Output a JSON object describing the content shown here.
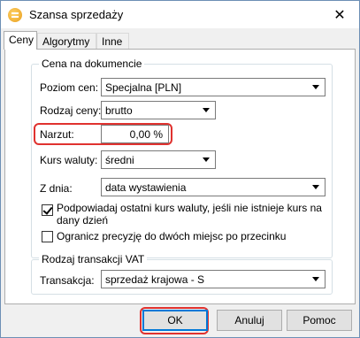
{
  "window": {
    "title": "Szansa sprzedaży",
    "close_glyph": "✕"
  },
  "tabs": [
    {
      "label": "Ceny",
      "active": true
    },
    {
      "label": "Algorytmy",
      "active": false
    },
    {
      "label": "Inne",
      "active": false
    }
  ],
  "price_group": {
    "legend": "Cena na dokumencie",
    "price_level": {
      "label": "Poziom cen:",
      "value": "Specjalna [PLN]"
    },
    "price_kind": {
      "label": "Rodzaj ceny:",
      "value": "brutto"
    },
    "markup": {
      "label": "Narzut:",
      "value": "0,00 %"
    },
    "exchange_rate": {
      "label": "Kurs waluty:",
      "value": "średni"
    },
    "from_date": {
      "label": "Z dnia:",
      "value": "data wystawienia"
    },
    "suggest_last_rate": {
      "label": "Podpowiadaj ostatni kurs waluty, jeśli nie istnieje kurs na dany dzień",
      "checked": true
    },
    "limit_precision": {
      "label": "Ogranicz precyzję do dwóch miejsc po przecinku",
      "checked": false
    }
  },
  "vat_group": {
    "legend": "Rodzaj transakcji VAT",
    "transaction": {
      "label": "Transakcja:",
      "value": "sprzedaż krajowa - S"
    }
  },
  "buttons": {
    "ok": "OK",
    "cancel": "Anuluj",
    "help": "Pomoc"
  },
  "colors": {
    "highlight": "#e0322f",
    "accent": "#0078d7"
  }
}
